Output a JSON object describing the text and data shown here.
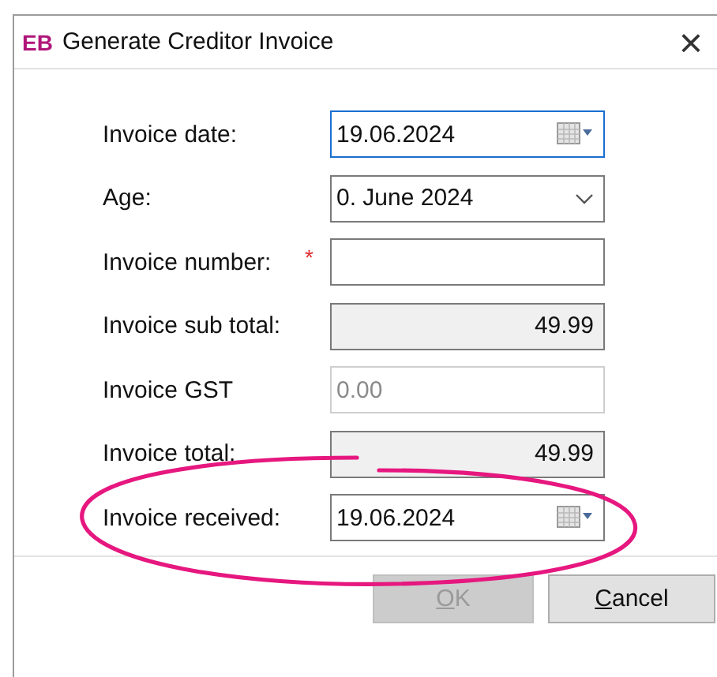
{
  "window": {
    "logo": "EB",
    "title": "Generate Creditor Invoice",
    "close": "×"
  },
  "fields": [
    {
      "label": "Invoice date:",
      "kind": "date",
      "value": "19.06.2024",
      "focused": true
    },
    {
      "label": "Age:",
      "kind": "select",
      "value": "0. June 2024",
      "focused": false
    },
    {
      "label": "Invoice number:",
      "kind": "text",
      "focused": false,
      "required_mark": "*"
    },
    {
      "label": "Invoice sub total:",
      "kind": "readonly",
      "value": "49.99",
      "focused": false
    },
    {
      "label": "Invoice GST",
      "kind": "disabled",
      "value": "0.00",
      "focused": false
    },
    {
      "label": "Invoice total:",
      "kind": "readonly",
      "value": "49.99",
      "focused": false
    },
    {
      "label": "Invoice received:",
      "kind": "date",
      "value": "19.06.2024",
      "focused": false
    }
  ],
  "buttons": [
    {
      "label": "OK",
      "disabled": true,
      "underline_first": true
    },
    {
      "label": "Cancel",
      "disabled": false,
      "underline_first": true
    }
  ],
  "annotations": [
    {
      "kind": "ellipse",
      "color": "#e6177f"
    }
  ]
}
